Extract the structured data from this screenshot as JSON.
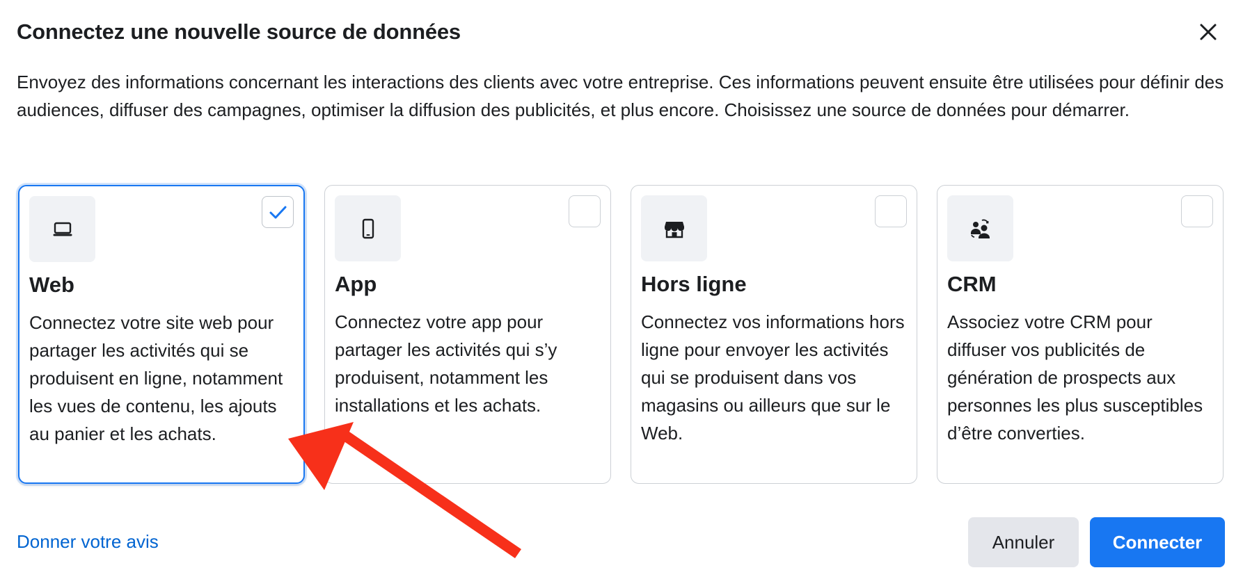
{
  "dialog": {
    "title": "Connectez une nouvelle source de données",
    "description": "Envoyez des informations concernant les interactions des clients avec votre entreprise. Ces informations peuvent ensuite être utilisées pour définir des audiences, diffuser des campagnes, optimiser la diffusion des publicités, et plus encore. Choisissez une source de données pour démarrer."
  },
  "cards": [
    {
      "title": "Web",
      "description": "Connectez votre site web pour partager les activités qui se produisent en ligne, notamment les vues de contenu, les ajouts au panier et les achats.",
      "icon": "laptop-icon",
      "selected": true
    },
    {
      "title": "App",
      "description": "Connectez votre app pour partager les activités qui s’y produisent, notamment les installations et les achats.",
      "icon": "phone-icon",
      "selected": false
    },
    {
      "title": "Hors ligne",
      "description": "Connectez vos informations hors ligne pour envoyer les activités qui se produisent dans vos magasins ou ailleurs que sur le Web.",
      "icon": "store-icon",
      "selected": false
    },
    {
      "title": "CRM",
      "description": "Associez votre CRM pour diffuser vos publicités de génération de prospects aux personnes les plus susceptibles d’être converties.",
      "icon": "people-sync-icon",
      "selected": false
    }
  ],
  "footer": {
    "feedback_link": "Donner votre avis",
    "cancel_label": "Annuler",
    "connect_label": "Connecter"
  },
  "colors": {
    "accent": "#1877f2",
    "link": "#0064d1",
    "annotation_arrow": "#f7301a"
  }
}
